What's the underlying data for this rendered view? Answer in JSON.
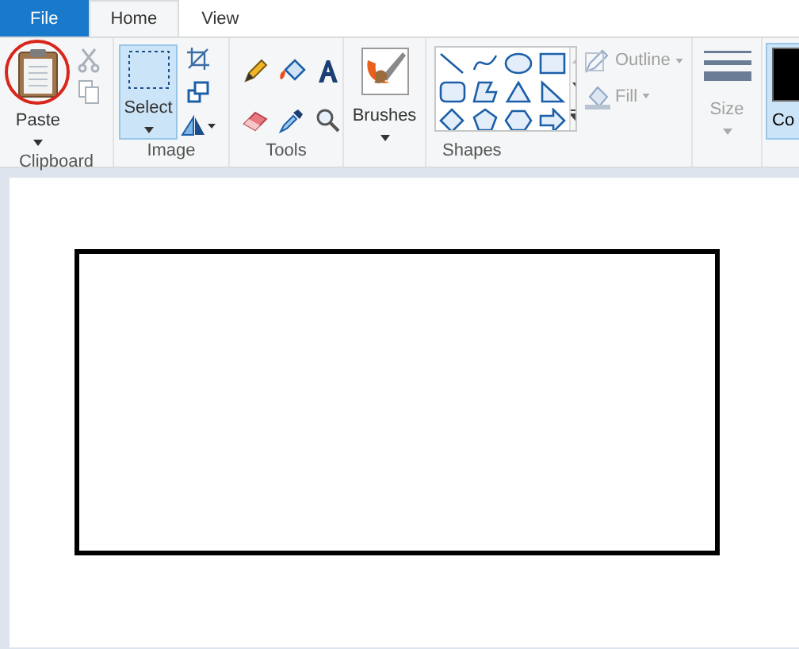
{
  "tabs": [
    {
      "label": "File",
      "kind": "file",
      "selected": false
    },
    {
      "label": "Home",
      "kind": "tab",
      "selected": true
    },
    {
      "label": "View",
      "kind": "tab",
      "selected": false
    }
  ],
  "clipboard": {
    "label": "Clipboard",
    "paste": {
      "label": "Paste",
      "circled": true
    },
    "cut": {
      "disabled": true
    },
    "copy": {
      "disabled": true
    }
  },
  "image": {
    "label": "Image",
    "select": {
      "label": "Select",
      "selected": true
    }
  },
  "tools": {
    "label": "Tools"
  },
  "brushes": {
    "label": "Brushes"
  },
  "shapes": {
    "label": "Shapes",
    "outline": {
      "label": "Outline",
      "disabled": true
    },
    "fill": {
      "label": "Fill",
      "disabled": true
    }
  },
  "size": {
    "label": "Size",
    "disabled": true
  },
  "color1": {
    "label": "Co",
    "selected": true
  },
  "canvas": {
    "shapes": [
      {
        "kind": "rectangle"
      }
    ]
  }
}
